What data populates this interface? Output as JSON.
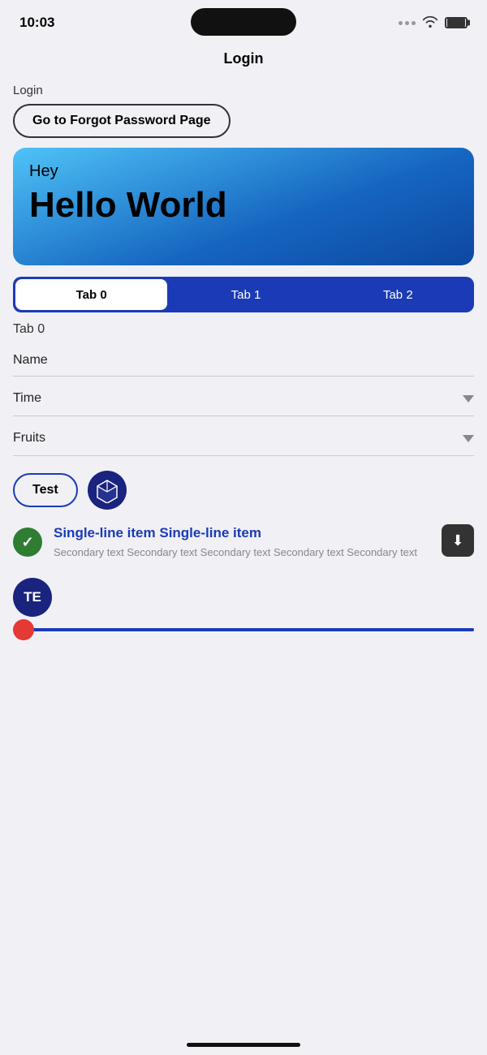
{
  "statusBar": {
    "time": "10:03"
  },
  "nav": {
    "title": "Login"
  },
  "loginSection": {
    "sectionLabel": "Login",
    "forgotPasswordButton": "Go to Forgot Password Page"
  },
  "heroBanner": {
    "hey": "Hey",
    "title": "Hello World"
  },
  "tabs": {
    "items": [
      {
        "label": "Tab 0",
        "active": true
      },
      {
        "label": "Tab 1",
        "active": false
      },
      {
        "label": "Tab 2",
        "active": false
      }
    ],
    "activeContent": "Tab 0"
  },
  "form": {
    "nameLabel": "Name",
    "timeLabel": "Time",
    "fruitsLabel": "Fruits"
  },
  "actions": {
    "testButton": "Test"
  },
  "listItem": {
    "title": "Single-line item Single-line item",
    "secondary": "Secondary text Secondary text Secondary text Secondary text Secondary text"
  },
  "avatar": {
    "initials": "TE"
  }
}
